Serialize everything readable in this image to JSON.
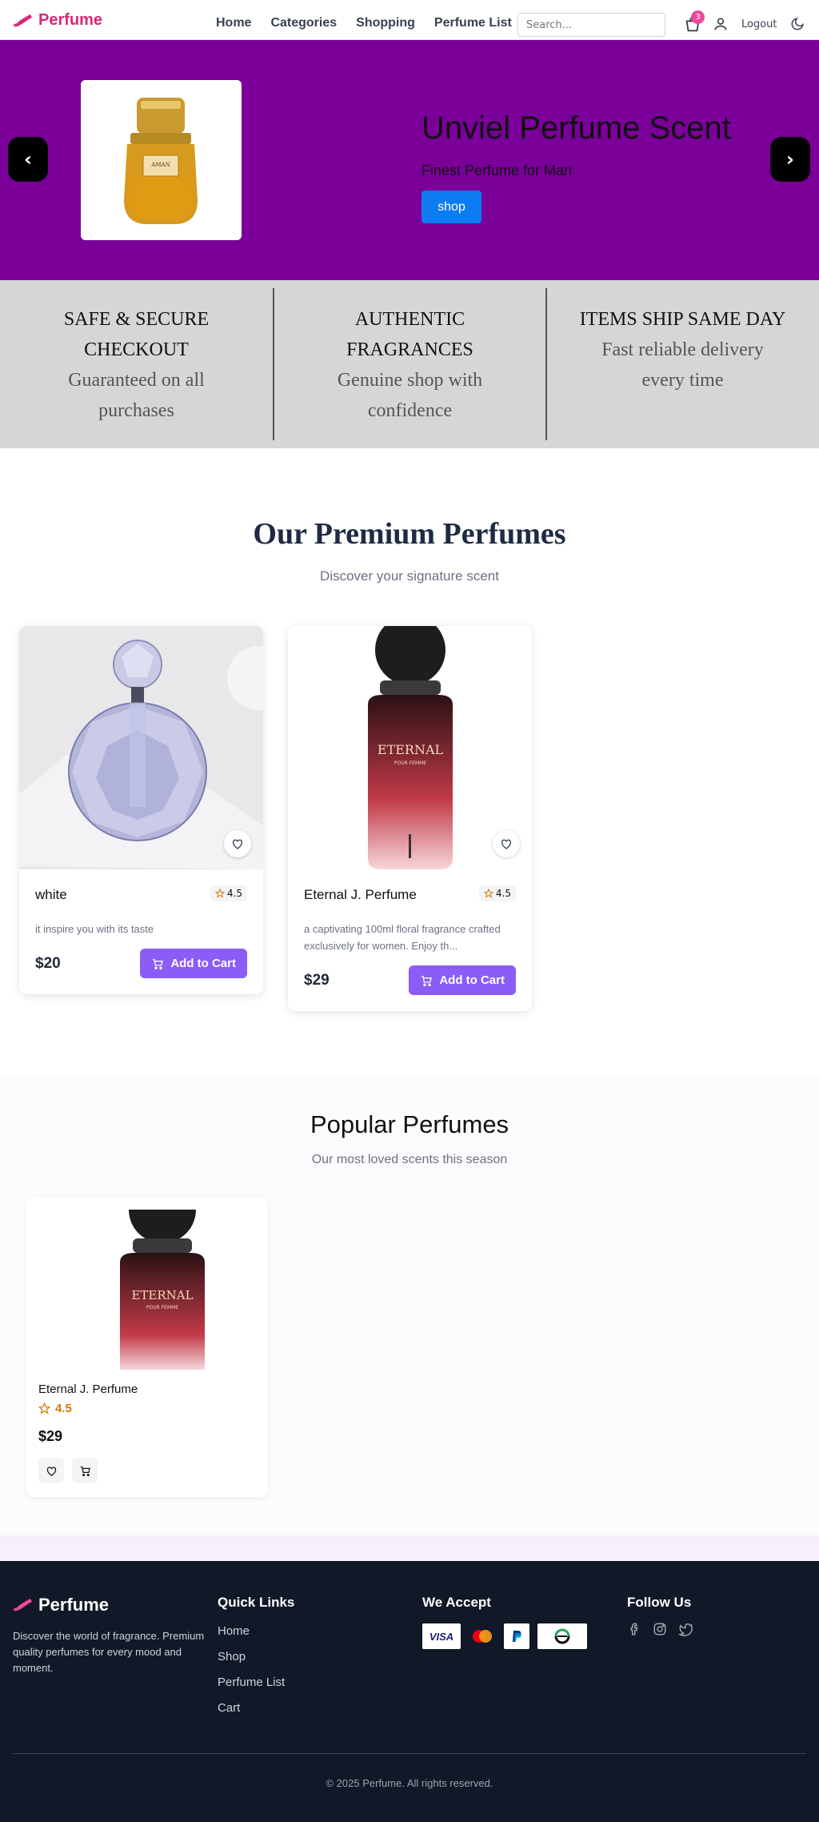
{
  "nav": {
    "brand": "Perfume",
    "links": [
      "Home",
      "Categories",
      "Shopping",
      "Perfume List"
    ],
    "search_placeholder": "Search...",
    "cart_count": "3",
    "logout": "Logout"
  },
  "hero": {
    "title": "Unviel Perfume Scent",
    "subtitle": "Finest Perfume for Man",
    "button": "shop",
    "prev": "‹",
    "next": "›",
    "bg_color": "#7a0099"
  },
  "features": [
    {
      "title": "SAFE & SECURE CHECKOUT",
      "desc": "Guaranteed on all purchases"
    },
    {
      "title": "AUTHENTIC FRAGRANCES",
      "desc": "Genuine shop with confidence"
    },
    {
      "title": "ITEMS SHIP SAME DAY",
      "desc": "Fast reliable delivery every time"
    }
  ],
  "premium": {
    "title": "Our Premium Perfumes",
    "subtitle": "Discover your signature scent",
    "products": [
      {
        "name": "white",
        "rating": "4.5",
        "desc": "it inspire you with its taste",
        "price": "$20",
        "button": "Add to Cart"
      },
      {
        "name": "Eternal J. Perfume",
        "rating": "4.5",
        "desc": "a captivating 100ml floral fragrance crafted exclusively for women. Enjoy th...",
        "price": "$29",
        "button": "Add to Cart"
      }
    ]
  },
  "popular": {
    "title": "Popular Perfumes",
    "subtitle": "Our most loved scents this season",
    "item": {
      "name": "Eternal J. Perfume",
      "rating": "4.5",
      "price": "$29"
    }
  },
  "footer": {
    "brand": "Perfume",
    "description": "Discover the world of fragrance. Premium quality perfumes for every mood and moment.",
    "quick_links_title": "Quick Links",
    "quick_links": [
      "Home",
      "Shop",
      "Perfume List",
      "Cart"
    ],
    "accept_title": "We Accept",
    "payments": [
      "VISA",
      "mastercard-icon",
      "paypal-icon",
      "easypaisa-icon"
    ],
    "follow_title": "Follow Us",
    "social": [
      "facebook-icon",
      "instagram-icon",
      "twitter-icon"
    ],
    "copyright": "© 2025 Perfume. All rights reserved."
  },
  "colors": {
    "brand": "#db2777",
    "accent": "#8b5cf6",
    "button_blue": "#0d7cf2",
    "footer": "#111827"
  }
}
